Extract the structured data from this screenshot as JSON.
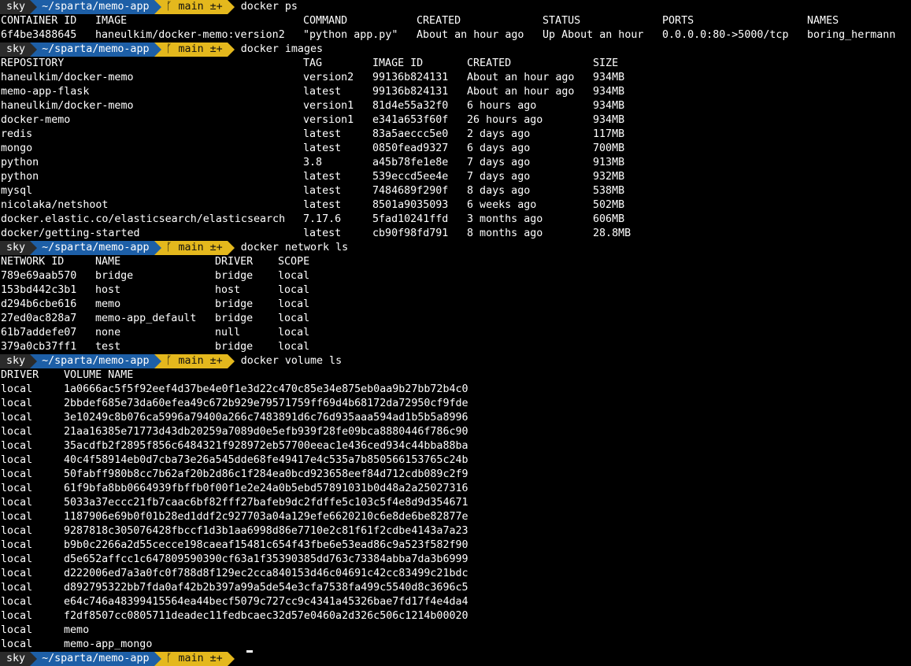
{
  "prompt": {
    "user": "sky",
    "path": "~/sparta/memo-app",
    "branch_icon": "branch-icon",
    "branch": "main",
    "git_status": "±+"
  },
  "commands": {
    "ps": "docker ps",
    "images": "docker images",
    "network": "docker network ls",
    "volume": "docker volume ls"
  },
  "ps": {
    "headers": [
      "CONTAINER ID",
      "IMAGE",
      "COMMAND",
      "CREATED",
      "STATUS",
      "PORTS",
      "NAMES"
    ],
    "rows": [
      [
        "6f4be3488645",
        "haneulkim/docker-memo:version2",
        "\"python app.py\"",
        "About an hour ago",
        "Up About an hour",
        "0.0.0.0:80->5000/tcp",
        "boring_hermann"
      ]
    ]
  },
  "images": {
    "headers": [
      "REPOSITORY",
      "TAG",
      "IMAGE ID",
      "CREATED",
      "SIZE"
    ],
    "rows": [
      [
        "haneulkim/docker-memo",
        "version2",
        "99136b824131",
        "About an hour ago",
        "934MB"
      ],
      [
        "memo-app-flask",
        "latest",
        "99136b824131",
        "About an hour ago",
        "934MB"
      ],
      [
        "haneulkim/docker-memo",
        "version1",
        "81d4e55a32f0",
        "6 hours ago",
        "934MB"
      ],
      [
        "docker-memo",
        "version1",
        "e341a653f60f",
        "26 hours ago",
        "934MB"
      ],
      [
        "redis",
        "latest",
        "83a5aeccc5e0",
        "2 days ago",
        "117MB"
      ],
      [
        "mongo",
        "latest",
        "0850fead9327",
        "6 days ago",
        "700MB"
      ],
      [
        "python",
        "3.8",
        "a45b78fe1e8e",
        "7 days ago",
        "913MB"
      ],
      [
        "python",
        "latest",
        "539eccd5ee4e",
        "7 days ago",
        "932MB"
      ],
      [
        "mysql",
        "latest",
        "7484689f290f",
        "8 days ago",
        "538MB"
      ],
      [
        "nicolaka/netshoot",
        "latest",
        "8501a9035093",
        "6 weeks ago",
        "502MB"
      ],
      [
        "docker.elastic.co/elasticsearch/elasticsearch",
        "7.17.6",
        "5fad10241ffd",
        "3 months ago",
        "606MB"
      ],
      [
        "docker/getting-started",
        "latest",
        "cb90f98fd791",
        "8 months ago",
        "28.8MB"
      ]
    ]
  },
  "network": {
    "headers": [
      "NETWORK ID",
      "NAME",
      "DRIVER",
      "SCOPE"
    ],
    "rows": [
      [
        "789e69aab570",
        "bridge",
        "bridge",
        "local"
      ],
      [
        "153bd442c3b1",
        "host",
        "host",
        "local"
      ],
      [
        "d294b6cbe616",
        "memo",
        "bridge",
        "local"
      ],
      [
        "27ed0ac828a7",
        "memo-app_default",
        "bridge",
        "local"
      ],
      [
        "61b7addefe07",
        "none",
        "null",
        "local"
      ],
      [
        "379a0cb37ff1",
        "test",
        "bridge",
        "local"
      ]
    ]
  },
  "volume": {
    "headers": [
      "DRIVER",
      "VOLUME NAME"
    ],
    "rows": [
      [
        "local",
        "1a0666ac5f5f92eef4d37be4e0f1e3d22c470c85e34e875eb0aa9b27bb72b4c0"
      ],
      [
        "local",
        "2bbdef685e73da60efea49c672b929e79571759ff69d4b68172da72950cf9fde"
      ],
      [
        "local",
        "3e10249c8b076ca5996a79400a266c7483891d6c76d935aaa594ad1b5b5a8996"
      ],
      [
        "local",
        "21aa16385e71773d43db20259a7089d0e5efb939f28fe09bca8880446f786c90"
      ],
      [
        "local",
        "35acdfb2f2895f856c6484321f928972eb57700eeac1e436ced934c44bba88ba"
      ],
      [
        "local",
        "40c4f58914eb0d7cba73e26a545dde68fe49417e4c535a7b850566153765c24b"
      ],
      [
        "local",
        "50fabff980b8cc7b62af20b2d86c1f284ea0bcd923658eef84d712cdb089c2f9"
      ],
      [
        "local",
        "61f9bfa8bb0664939fbffb0f00f1e2e24a0b5ebd57891031b0d48a2a25027316"
      ],
      [
        "local",
        "5033a37eccc21fb7caac6bf82fff27bafeb9dc2fdffe5c103c5f4e8d9d354671"
      ],
      [
        "local",
        "1187906e69b0f01b28ed1ddf2c927703a04a129efe6620210c6e8de6be82877e"
      ],
      [
        "local",
        "9287818c305076428fbccf1d3b1aa6998d86e7710e2c81f61f2cdbe4143a7a23"
      ],
      [
        "local",
        "b9b0c2266a2d55cecce198caeaf15481c654f43fbe6e53ead86c9a523f582f90"
      ],
      [
        "local",
        "d5e652affcc1c647809590390cf63a1f35390385dd763c73384abba7da3b6999"
      ],
      [
        "local",
        "d222006ed7a3a0fc0f788d8f129ec2cca840153d46c04691c42cc83499c21bdc"
      ],
      [
        "local",
        "d892795322bb7fda0af42b2b397a99a5de54e3cfa7538fa499c5540d8c3696c5"
      ],
      [
        "local",
        "e64c746a48399415564ea44becf5079c727cc9c4341a45326bae7fd17f4e4da4"
      ],
      [
        "local",
        "f2df8507cc0805711deadec11fedbcaec32d57e0460a2d326c506c1214b00020"
      ],
      [
        "local",
        "memo"
      ],
      [
        "local",
        "memo-app_mongo"
      ]
    ]
  },
  "colors": {
    "path_bg": "#1d5fa7",
    "git_bg": "#e4b81d",
    "user_bg": "#2b2b2b"
  }
}
